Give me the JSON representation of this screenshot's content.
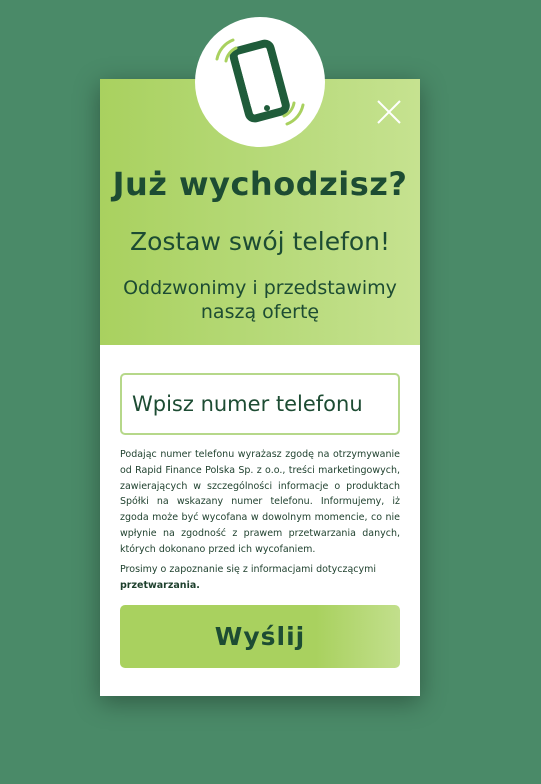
{
  "modal": {
    "title": "Już wychodzisz?",
    "subtitle": "Zostaw swój telefon!",
    "subtitle2": "Oddzwonimy i przedstawimy naszą ofertę",
    "close_icon": "close-icon",
    "badge_icon": "ringing-phone-icon"
  },
  "form": {
    "phone_placeholder": "Wpisz numer telefonu",
    "consent_text": "Podając numer telefonu wyrażasz zgodę na otrzymywanie od Rapid Finance Polska Sp. z o.o., treści marketingowych, zawierających w szczególności informacje o produktach Spółki na wskazany numer telefonu. Informujemy, iż zgoda może być wycofana w dowolnym momencie, co nie wpłynie na zgodność z prawem przetwarzania danych, których dokonano przed ich wycofaniem.",
    "info_text": "Prosimy o zapoznanie się z informacjami dotyczącymi",
    "info_link": "przetwarzania.",
    "submit_label": "Wyślij"
  },
  "colors": {
    "background": "#4a8a68",
    "accent_green": "#a9d15f",
    "dark_green": "#1d4c33",
    "phone_icon": "#1f5c3a"
  }
}
